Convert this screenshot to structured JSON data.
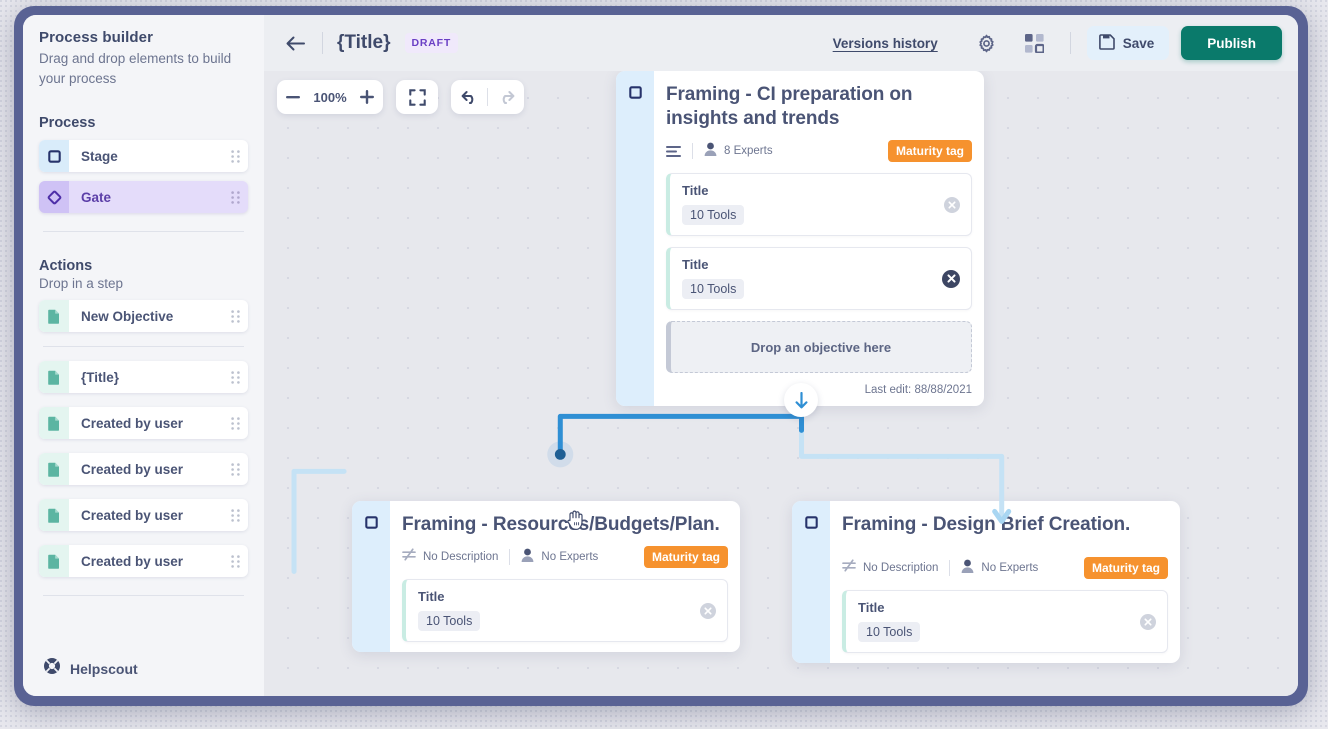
{
  "sidebar": {
    "title": "Process builder",
    "subtitle": "Drag and drop elements to build your process",
    "process_section": {
      "label": "Process"
    },
    "process_items": [
      {
        "label": "Stage",
        "icon": "square-icon"
      },
      {
        "label": "Gate",
        "icon": "diamond-icon"
      }
    ],
    "actions_section": {
      "label": "Actions",
      "sub": "Drop in a step"
    },
    "action_items": [
      {
        "label": "New Objective",
        "icon": "document-icon"
      }
    ],
    "created_items": [
      {
        "label": "{Title}",
        "icon": "document-icon"
      },
      {
        "label": "Created by user",
        "icon": "document-icon"
      },
      {
        "label": "Created by user",
        "icon": "document-icon"
      },
      {
        "label": "Created by user",
        "icon": "document-icon"
      },
      {
        "label": "Created by user",
        "icon": "document-icon"
      }
    ],
    "helpscout": {
      "label": "Helpscout",
      "icon": "lifebuoy-icon"
    }
  },
  "header": {
    "back": "back-arrow-icon",
    "title": "{Title}",
    "status_badge": "DRAFT",
    "versions_link": "Versions history",
    "settings_icon": "gear-icon",
    "apps_icon": "grid-icon",
    "save_label": "Save",
    "publish_label": "Publish"
  },
  "toolbar": {
    "zoom_out": "−",
    "zoom_level": "100%",
    "zoom_in": "+",
    "fit_icon": "fullscreen-icon",
    "undo_icon": "undo-icon",
    "redo_icon": "redo-icon"
  },
  "cards": [
    {
      "id": "card-top",
      "title": "Framing - CI preparation on insights and trends",
      "description_label": "",
      "description_icon": "description-lines-icon",
      "experts_label": "8 Experts",
      "experts_icon": "person-icon",
      "maturity_tag": "Maturity tag",
      "objectives": [
        {
          "title": "Title",
          "chip": "10 Tools",
          "close_state": "normal"
        },
        {
          "title": "Title",
          "chip": "10 Tools",
          "close_state": "active"
        }
      ],
      "dropzone": "Drop an objective here",
      "last_edit": "Last edit: 88/88/2021"
    },
    {
      "id": "card-bottom-left",
      "title": "Framing - Resources/Budgets/Plan.",
      "description_label": "No Description",
      "description_icon": "no-description-icon",
      "experts_label": "No Experts",
      "experts_icon": "person-icon",
      "maturity_tag": "Maturity tag",
      "objectives": [
        {
          "title": "Title",
          "chip": "10 Tools",
          "close_state": "normal"
        }
      ]
    },
    {
      "id": "card-bottom-right",
      "title": "Framing - Design Brief Creation.",
      "description_label": "No Description",
      "description_icon": "no-description-icon",
      "experts_label": "No Experts",
      "experts_icon": "person-icon",
      "maturity_tag": "Maturity tag",
      "objectives": [
        {
          "title": "Title",
          "chip": "10 Tools",
          "close_state": "normal"
        }
      ]
    }
  ],
  "colors": {
    "publish": "#0a7a6b",
    "save_bg": "#e3f0fb",
    "maturity_tag": "#f6922e",
    "draft_badge_text": "#6a3fc4",
    "gate_bg": "#e4dcfa",
    "stage_strip": "#ddeefc",
    "connector_active": "#2f8fd4",
    "connector_idle": "#c5e2f5",
    "frame": "#596294",
    "text_primary": "#4a5475",
    "text_muted": "#6d7590"
  }
}
